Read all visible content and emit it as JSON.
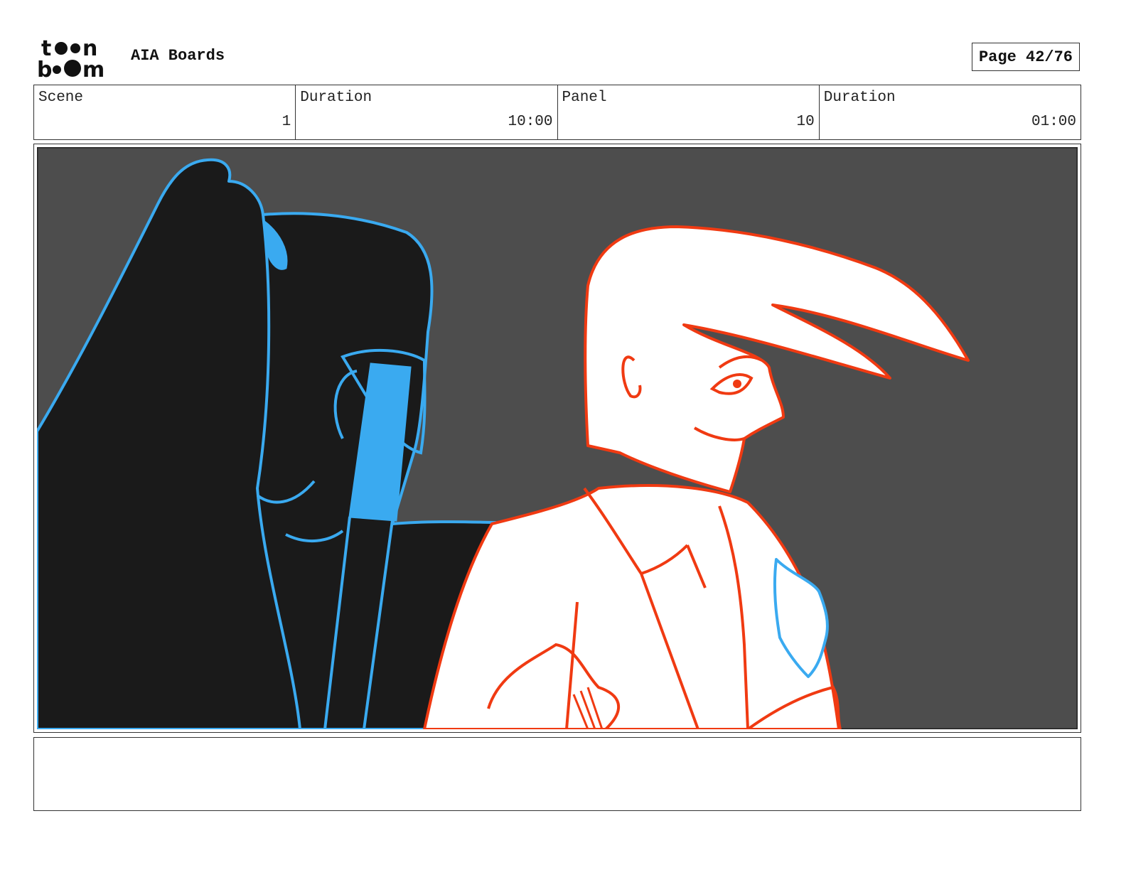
{
  "header": {
    "logo_text": "toon boom",
    "project_title": "AIA Boards",
    "page_label": "Page 42/76"
  },
  "info": {
    "scene_label": "Scene",
    "scene_value": "1",
    "scene_duration_label": "Duration",
    "scene_duration_value": "10:00",
    "panel_label": "Panel",
    "panel_value": "10",
    "panel_duration_label": "Duration",
    "panel_duration_value": "01:00"
  },
  "colors": {
    "background": "#4d4d4d",
    "hair_fill": "#1a1a1a",
    "blue_line": "#3aaaf0",
    "red_line": "#f03a12",
    "white_fill": "#ffffff"
  },
  "notes": {
    "text": ""
  }
}
